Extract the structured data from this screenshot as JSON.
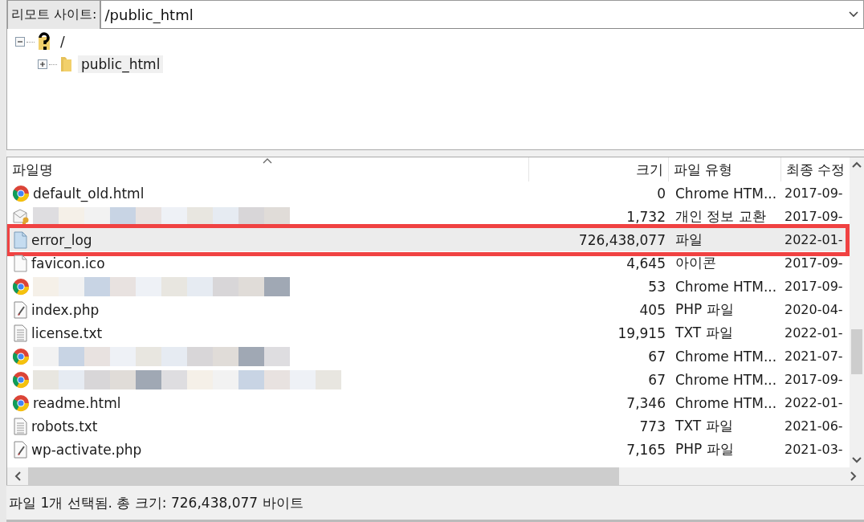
{
  "remote_site": {
    "label": "리모트 사이트:",
    "path": "/public_html"
  },
  "tree": [
    {
      "name": "/",
      "kind": "unknown",
      "expanded": true,
      "selected": false,
      "children": [
        {
          "name": "public_html",
          "kind": "folder",
          "expanded": false,
          "selected": true
        }
      ]
    }
  ],
  "file_list": {
    "columns": [
      {
        "label": "파일명",
        "sorted": true
      },
      {
        "label": "크기",
        "sorted": false
      },
      {
        "label": "파일 유형",
        "sorted": false
      },
      {
        "label": "최종 수정",
        "sorted": false
      }
    ],
    "rows": [
      {
        "kind": "chrome",
        "name": "default_old.html",
        "size": "0",
        "type": "Chrome HTM...",
        "modified": "2017-09-",
        "selected": false,
        "highlighted": false
      },
      {
        "kind": "certificate",
        "redacted": true,
        "size": "1,732",
        "type": "개인 정보 교환",
        "modified": "2017-09-",
        "selected": false,
        "highlighted": false
      },
      {
        "kind": "file",
        "name": "error_log",
        "size": "726,438,077",
        "type": "파일",
        "modified": "2022-01-",
        "selected": true,
        "highlighted": true
      },
      {
        "kind": "blank",
        "name": "favicon.ico",
        "size": "4,645",
        "type": "아이콘",
        "modified": "2017-09-",
        "selected": false,
        "highlighted": false
      },
      {
        "kind": "chrome",
        "redacted": true,
        "size": "53",
        "type": "Chrome HTM...",
        "modified": "2017-09-",
        "selected": false,
        "highlighted": false
      },
      {
        "kind": "php",
        "name": "index.php",
        "size": "405",
        "type": "PHP 파일",
        "modified": "2020-04-",
        "selected": false,
        "highlighted": false
      },
      {
        "kind": "text",
        "name": "license.txt",
        "size": "19,915",
        "type": "TXT 파일",
        "modified": "2022-01-",
        "selected": false,
        "highlighted": false
      },
      {
        "kind": "chrome",
        "redacted": true,
        "size": "67",
        "type": "Chrome HTM...",
        "modified": "2021-07-",
        "selected": false,
        "highlighted": false
      },
      {
        "kind": "chrome",
        "redacted": true,
        "size": "67",
        "type": "Chrome HTM...",
        "modified": "2017-09-",
        "selected": false,
        "highlighted": false
      },
      {
        "kind": "chrome",
        "name": "readme.html",
        "size": "7,346",
        "type": "Chrome HTM...",
        "modified": "2022-01-",
        "selected": false,
        "highlighted": false
      },
      {
        "kind": "text",
        "name": "robots.txt",
        "size": "773",
        "type": "TXT 파일",
        "modified": "2021-06-",
        "selected": false,
        "highlighted": false
      },
      {
        "kind": "php",
        "name": "wp-activate.php",
        "size": "7,165",
        "type": "PHP 파일",
        "modified": "2021-03-",
        "selected": false,
        "highlighted": false
      }
    ]
  },
  "status_bar": {
    "text": "파일 1개 선택됨. 총 크기: 726,438,077 바이트"
  }
}
